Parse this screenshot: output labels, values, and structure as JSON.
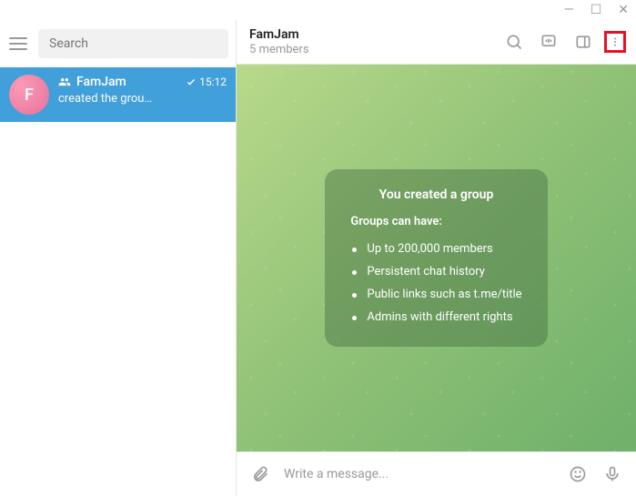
{
  "window": {
    "min": "—",
    "max": "☐",
    "close": "✕"
  },
  "sidebar": {
    "search_placeholder": "Search",
    "chat": {
      "avatar_letter": "F",
      "name": "FamJam",
      "time": "15:12",
      "preview": "created the grou…"
    }
  },
  "header": {
    "title": "FamJam",
    "subtitle": "5 members"
  },
  "info": {
    "title": "You created a group",
    "subtitle": "Groups can have:",
    "items": [
      "Up to 200,000 members",
      "Persistent chat history",
      "Public links such as t.me/title",
      "Admins with different rights"
    ]
  },
  "composer": {
    "placeholder": "Write a message..."
  }
}
